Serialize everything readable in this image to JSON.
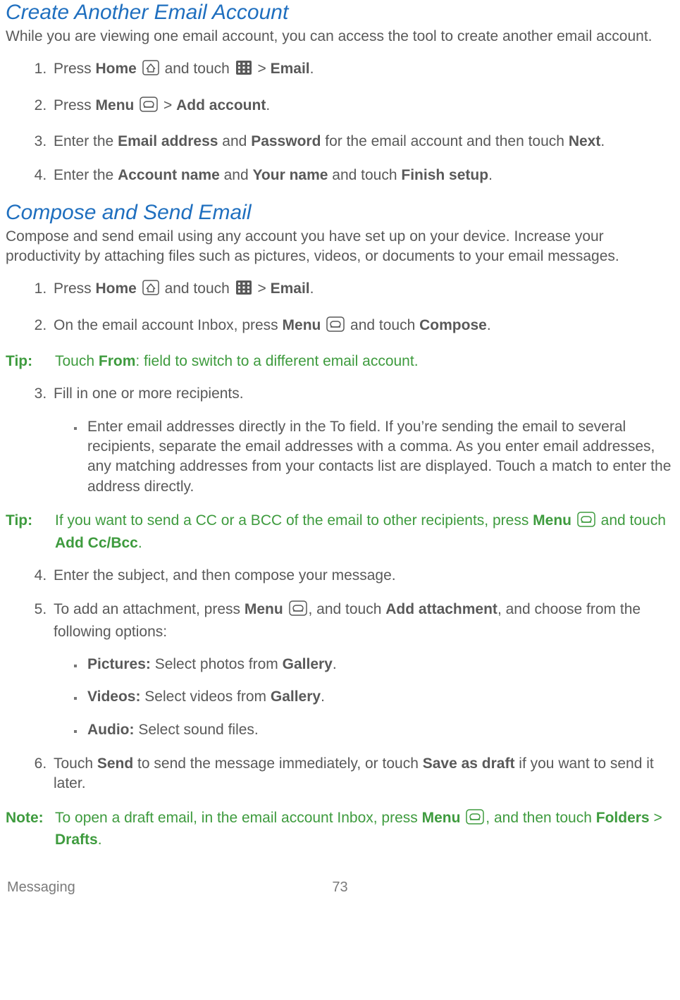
{
  "sections": {
    "create": {
      "title": "Create Another Email Account",
      "intro": "While you are viewing one email account, you can access the tool to create another email account.",
      "steps": {
        "s1_a": "Press ",
        "s1_home": "Home",
        "s1_b": " and touch ",
        "s1_gt": " > ",
        "s1_email": "Email",
        "s1_end": ".",
        "s2_a": "Press ",
        "s2_menu": "Menu",
        "s2_gt": " > ",
        "s2_add": "Add account",
        "s2_end": ".",
        "s3_a": "Enter the ",
        "s3_email": "Email address",
        "s3_b": " and ",
        "s3_pw": "Password",
        "s3_c": " for the email account and then touch ",
        "s3_next": "Next",
        "s3_end": ".",
        "s4_a": "Enter the ",
        "s4_acct": "Account name",
        "s4_b": " and ",
        "s4_your": "Your name",
        "s4_c": " and touch ",
        "s4_finish": "Finish setup",
        "s4_end": "."
      }
    },
    "compose": {
      "title": "Compose and Send Email",
      "intro": "Compose and send email using any account you have set up on your device. Increase your productivity by attaching files such as pictures, videos, or documents to your email messages.",
      "steps": {
        "s1_a": "Press ",
        "s1_home": "Home",
        "s1_b": " and touch ",
        "s1_gt": " > ",
        "s1_email": "Email",
        "s1_end": ".",
        "s2_a": "On the email account Inbox, press ",
        "s2_menu": "Menu",
        "s2_b": " and touch ",
        "s2_compose": "Compose",
        "s2_end": ".",
        "s3": "Fill in one or more recipients.",
        "s3_sub": "Enter email addresses directly in the To field. If you’re sending the email to several recipients, separate the email addresses with a comma. As you enter email addresses, any matching addresses from your contacts list are displayed. Touch a match to enter the address directly.",
        "s4": "Enter the subject, and then compose your message.",
        "s5_a": "To add an attachment, press ",
        "s5_menu": "Menu",
        "s5_b": ", and touch ",
        "s5_add": "Add attachment",
        "s5_c": ", and choose from the following options:",
        "s5_opt1_a": "Pictures:",
        "s5_opt1_b": " Select photos from ",
        "s5_opt1_c": "Gallery",
        "s5_opt1_d": ".",
        "s5_opt2_a": "Videos:",
        "s5_opt2_b": " Select videos from ",
        "s5_opt2_c": "Gallery",
        "s5_opt2_d": ".",
        "s5_opt3_a": "Audio:",
        "s5_opt3_b": " Select sound files.",
        "s6_a": "Touch ",
        "s6_send": "Send",
        "s6_b": " to send the message immediately, or touch ",
        "s6_save": "Save as draft",
        "s6_c": " if you want to send it later."
      },
      "tips": {
        "tip_label": "Tip:",
        "note_label": "Note:",
        "tip1_a": "Touch ",
        "tip1_from": "From",
        "tip1_b": ": field to switch to a different email account.",
        "tip2_a": "If you want to send a CC or a BCC of the email to other recipients, press ",
        "tip2_menu": "Menu",
        "tip2_b": " and touch ",
        "tip2_cc": "Add Cc/Bcc",
        "tip2_c": ".",
        "note_a": "To open a draft email, in the email account Inbox, press ",
        "note_menu": "Menu",
        "note_b": ", and then touch ",
        "note_folders": "Folders",
        "note_gt": " > ",
        "note_drafts": "Drafts",
        "note_c": "."
      }
    }
  },
  "footer": {
    "section": "Messaging",
    "page": "73"
  }
}
